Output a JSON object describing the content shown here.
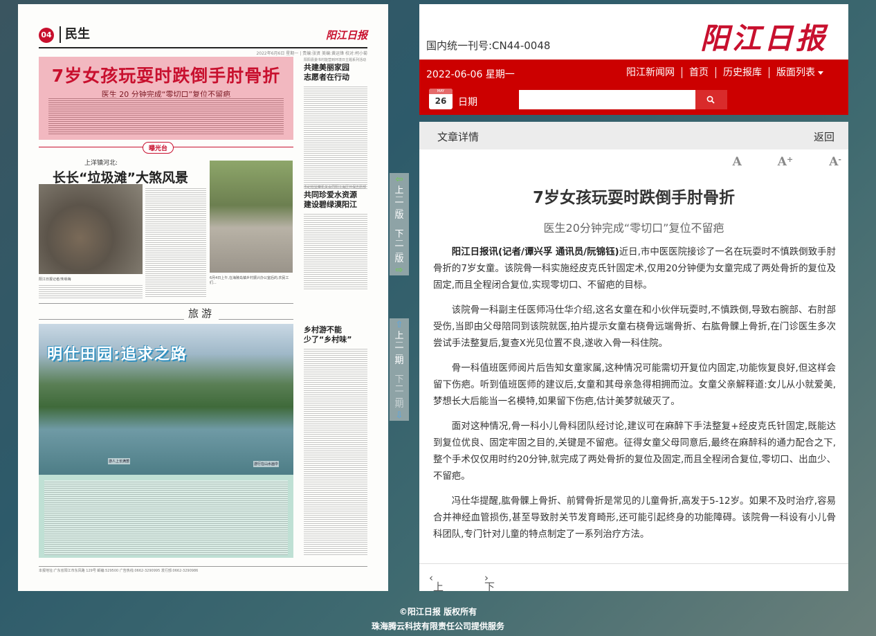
{
  "paper": {
    "page_num": "04",
    "section": "民生",
    "logo": "阳江日报",
    "date_line": "2022年6月6日 星期一 | 责编:张贤 美编:黄运锋 校对:柯小菊",
    "headline": "7岁女孩玩耍时跌倒手肘骨折",
    "subhead": "医生 20 分钟完成“零切口”复位不留疤",
    "side1_kicker": "阳阳县委书村能营到环境日主题系列活动",
    "side1_title": "共建美丽家园\n志愿者在行动",
    "badge": "曝光台",
    "art2_kicker": "上洋镇河北:",
    "art2_title": "长长“垃圾滩”大煞风景",
    "cap1": "阳江日报记者/朱咏梅",
    "cap2": "6月4日上午,在海陵岛镇乡村振兴办公室后的,农民工们...",
    "side2_kicker": "市纪检监察机关会同阳江海区环保志愿部",
    "side2_title": "共同珍爱水资源\n建设碧绿漠阳江",
    "travel_label": "旅游",
    "travel_title": "明仕田园:追求之路",
    "travel_cap1": "游人上长满葱",
    "travel_cap2": "游行在山水画中",
    "side3_title": "乡村游不能\n少了“乡村味”",
    "footer_line": "本报地址:广东省阳江市东风路 129号   邮编:529500   广告热线:0662-3290995   发行部:0662-3290986"
  },
  "pager": {
    "prev_page": [
      "上",
      "一",
      "版"
    ],
    "next_page": [
      "下",
      "一",
      "版"
    ],
    "prev_issue": [
      "上",
      "一",
      "期"
    ],
    "next_issue": [
      "下",
      "一",
      "期"
    ]
  },
  "header": {
    "issn": "国内统一刊号:CN44-0048",
    "logo": "阳江日报",
    "date": "2022-06-06  星期一",
    "nav": [
      "阳江新闻网",
      "首页",
      "历史报库",
      "版面列表"
    ],
    "cal_month": "MAY",
    "cal_day": "26",
    "date_label": "日期",
    "search_value": ""
  },
  "article": {
    "bar_label": "文章详情",
    "back_label": "返回",
    "font_a": "A",
    "font_plus": "A",
    "font_plus_sign": "+",
    "font_minus": "A",
    "font_minus_sign": "-",
    "title": "7岁女孩玩耍时跌倒手肘骨折",
    "subtitle": "医生20分钟完成“零切口”复位不留疤",
    "lead_bold": "阳江日报讯(记者/谭兴孚  通讯员/阮锦钰)",
    "p1": "近日,市中医医院接诊了一名在玩耍时不慎跌倒致手肘骨折的7岁女童。该院骨一科实施经皮克氏针固定术,仅用20分钟便为女童完成了两处骨折的复位及固定,而且全程闭合复位,实现零切口、不留疤的目标。",
    "p2": "该院骨一科副主任医师冯仕华介绍,这名女童在和小伙伴玩耍时,不慎跌倒,导致右腕部、右肘部受伤,当即由父母陪同到该院就医,拍片提示女童右桡骨远端骨折、右肱骨髁上骨折,在门诊医生多次尝试手法整复后,复查X光见位置不良,遂收入骨一科住院。",
    "p3": "骨一科值班医师阅片后告知女童家属,这种情况可能需切开复位内固定,功能恢复良好,但这样会留下伤疤。听到值班医师的建议后,女童和其母亲急得相拥而泣。女童父亲解释道:女儿从小就爱美,梦想长大后能当一名模特,如果留下伤疤,估计美梦就破灭了。",
    "p4": "面对这种情况,骨一科小儿骨科团队经讨论,建议可在麻醉下手法整复+经皮克氏针固定,既能达到复位优良、固定牢固之目的,关键是不留疤。征得女童父母同意后,最终在麻醉科的通力配合之下,整个手术仅仅用时约20分钟,就完成了两处骨折的复位及固定,而且全程闭合复位,零切口、出血少、不留疤。",
    "p5": "冯仕华提醒,肱骨髁上骨折、前臂骨折是常见的儿童骨折,高发于5-12岁。如果不及时治疗,容易合并神经血管损伤,甚至导致肘关节发育畸形,还可能引起终身的功能障碍。该院骨一科设有小儿骨科团队,专门针对儿童的特点制定了一系列治疗方法。",
    "prev": "上一篇",
    "next": "下一篇"
  },
  "footer": {
    "copyright": "©阳江日报 版权所有",
    "provider": "珠海腾云科技有限责任公司提供服务"
  },
  "colors": {
    "brand_red": "#c00",
    "search_btn": "#d92b2b",
    "panel_grey": "#ececec"
  }
}
